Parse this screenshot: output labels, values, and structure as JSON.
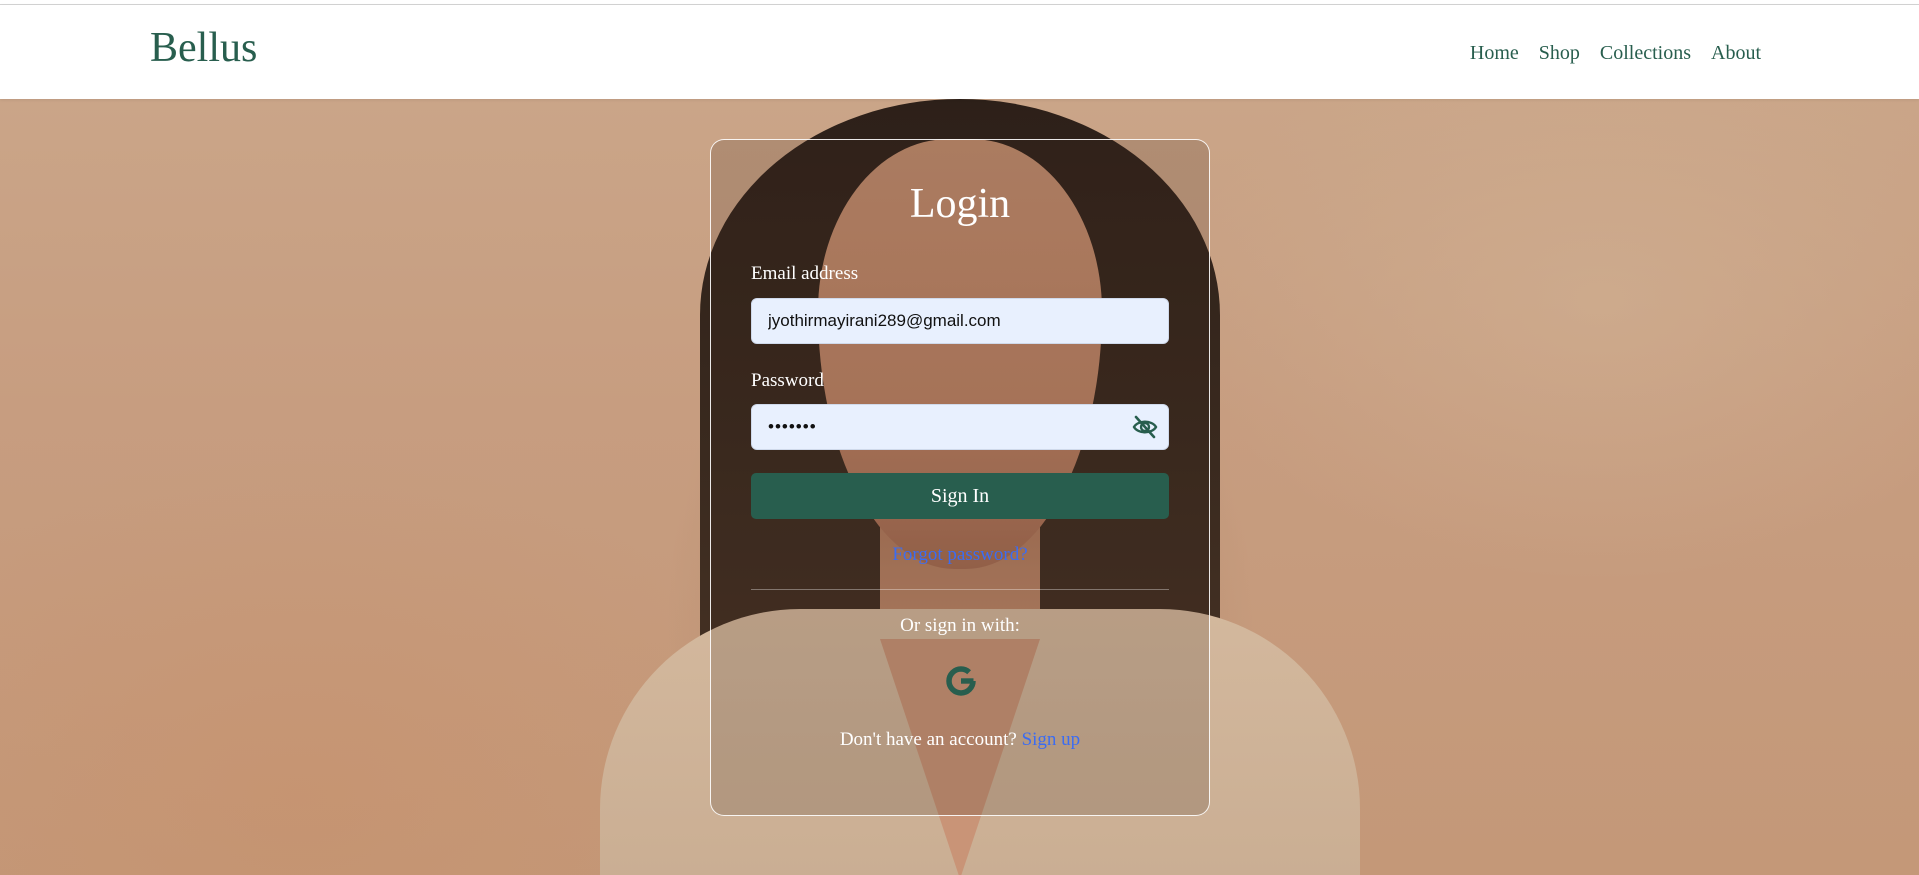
{
  "header": {
    "brand": "Bellus",
    "nav": [
      "Home",
      "Shop",
      "Collections",
      "About"
    ]
  },
  "login": {
    "title": "Login",
    "email_label": "Email address",
    "email_value": "jyothirmayirani289@gmail.com",
    "password_label": "Password",
    "password_value": "•••••••",
    "toggle_icon": "eye-slash-icon",
    "signin_label": "Sign In",
    "forgot_label": "Forgot password?",
    "or_label": "Or sign in with:",
    "social_icon": "google-icon",
    "no_account_label": "Don't have an account?",
    "signup_label": "Sign up"
  },
  "colors": {
    "brand_green": "#285e4e",
    "link_blue": "#3b6cf2",
    "field_bg": "#e8f0fe"
  }
}
